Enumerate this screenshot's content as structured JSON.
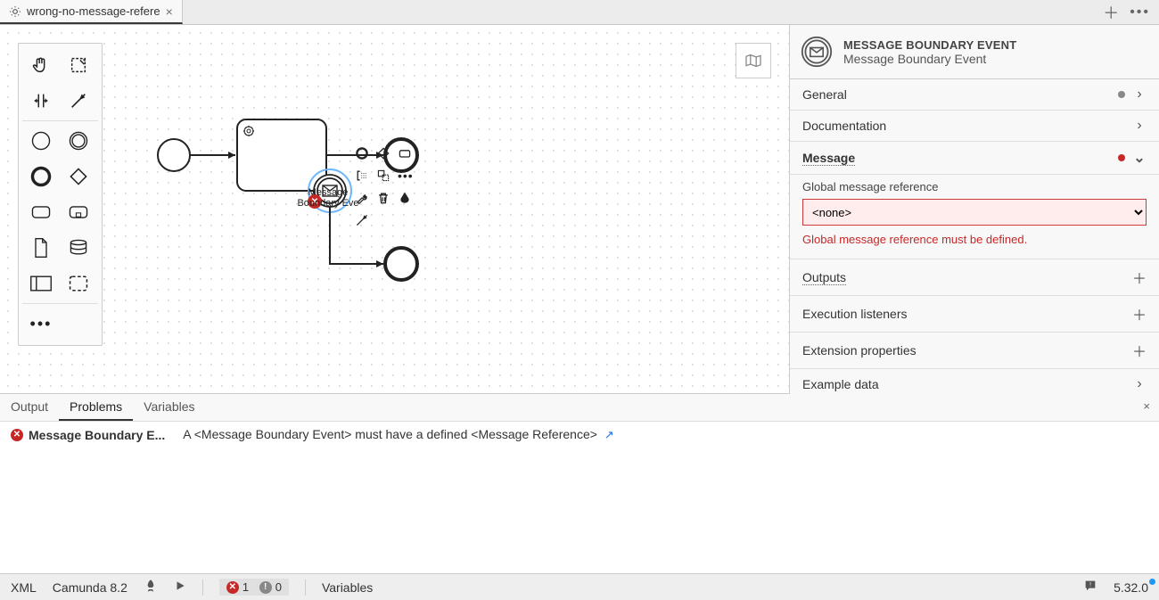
{
  "tab": {
    "title": "wrong-no-message-refere"
  },
  "canvas": {
    "boundary_event_label": "Message Boundary Eve..."
  },
  "props": {
    "type_label": "MESSAGE BOUNDARY EVENT",
    "name": "Message Boundary Event",
    "groups": {
      "general": "General",
      "documentation": "Documentation",
      "message": "Message",
      "outputs": "Outputs",
      "execution_listeners": "Execution listeners",
      "extension_properties": "Extension properties",
      "example_data": "Example data"
    },
    "message": {
      "field_label": "Global message reference",
      "value": "<none>",
      "error": "Global message reference must be defined."
    }
  },
  "bottom_tabs": {
    "output": "Output",
    "problems": "Problems",
    "variables": "Variables"
  },
  "problem": {
    "name": "Message Boundary E...",
    "desc": "A <Message Boundary Event> must have a defined <Message Reference>"
  },
  "status": {
    "xml": "XML",
    "engine": "Camunda 8.2",
    "errors": "1",
    "warnings": "0",
    "variables": "Variables",
    "version": "5.32.0"
  }
}
